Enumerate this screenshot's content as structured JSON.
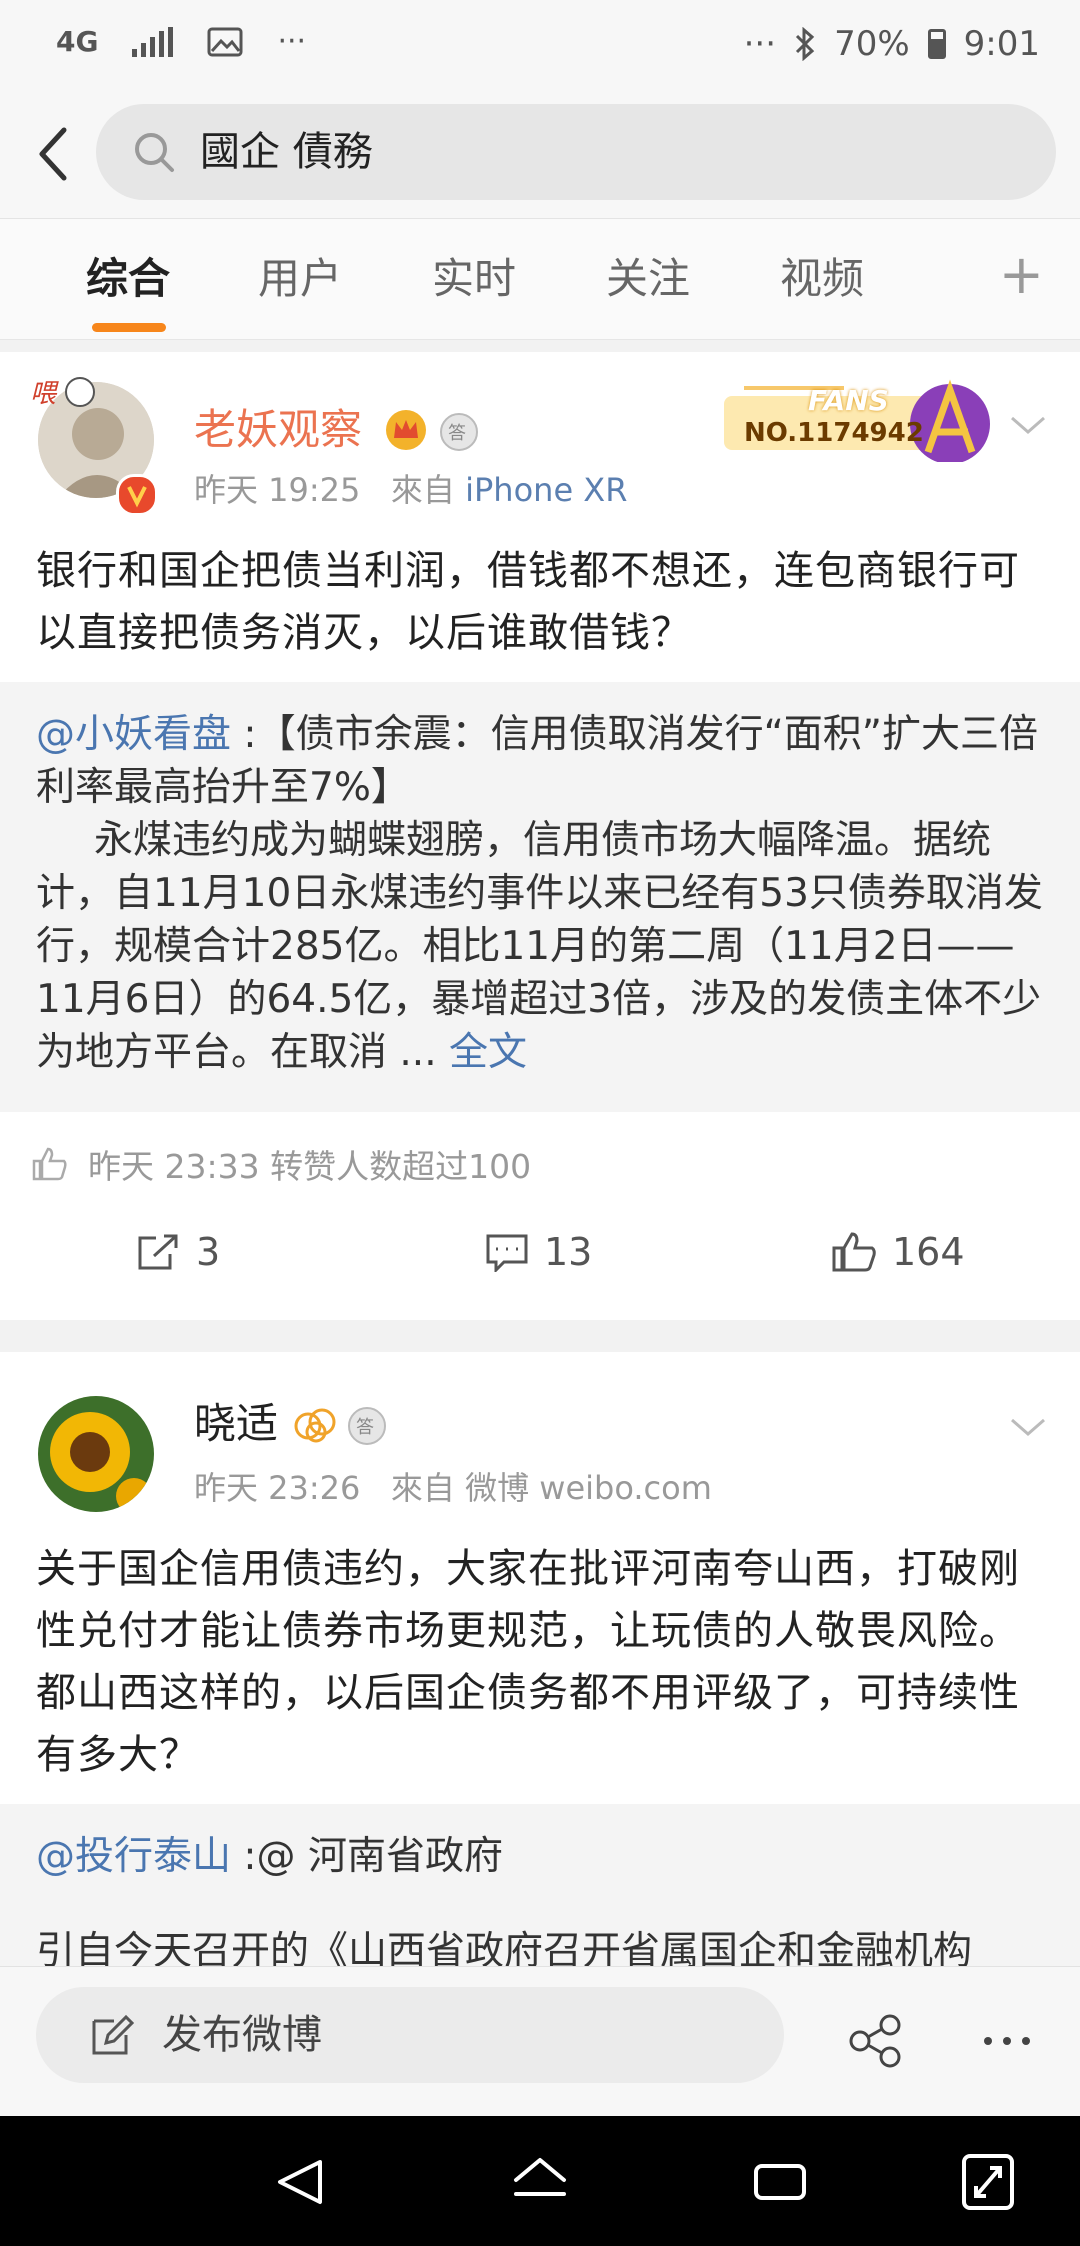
{
  "status_bar": {
    "network": "4G",
    "dots_left": "···",
    "dots_right": "···",
    "battery": "70%",
    "time": "9:01"
  },
  "search": {
    "query": "國企 債務"
  },
  "tabs": [
    {
      "label": "综合",
      "active": true
    },
    {
      "label": "用户",
      "active": false
    },
    {
      "label": "实时",
      "active": false
    },
    {
      "label": "关注",
      "active": false
    },
    {
      "label": "视频",
      "active": false
    }
  ],
  "tab_more": "+",
  "posts": [
    {
      "username": "老妖观察",
      "time": "昨天 19:25",
      "source_prefix": "來自",
      "source": "iPhone XR",
      "fans_badge": {
        "label": "FANS",
        "number": "NO.1174942"
      },
      "text": "银行和国企把债当利润，借钱都不想还，连包商银行可以直接把债务消灭，以后谁敢借钱？",
      "repost_author": "@小妖看盘",
      "repost_colon": ":",
      "repost_title": "【债市余震：信用债取消发行“面积”扩大三倍 利率最高抬升至7%】",
      "repost_body": "永煤违约成为蝴蝶翅膀，信用债市场大幅降温。据统计，自11月10日永煤违约事件以来已经有53只债券取消发行，规模合计285亿。相比11月的第二周（11月2日——11月6日）的64.5亿，暴增超过3倍，涉及的发债主体不少为地方平台。在取消 ...",
      "repost_more": "全文",
      "liked_info": "昨天 23:33 转赞人数超过100",
      "reposts": "3",
      "comments": "13",
      "likes": "164"
    },
    {
      "username": "晓适",
      "time": "昨天 23:26",
      "source_prefix": "來自",
      "source": "微博 weibo.com",
      "text": "关于国企信用债违约，大家在批评河南夸山西，打破刚性兑付才能让债券市场更规范，让玩债的人敬畏风险。都山西这样的，以后国企债务都不用评级了，可持续性有多大？",
      "repost_author": "@投行泰山",
      "repost_title": ":@ 河南省政府",
      "repost_body_partial": "引自今天召开的《山西省政府召开省属国企和金融机构"
    }
  ],
  "compose": {
    "label": "发布微博"
  },
  "colors": {
    "accent": "#f7861b",
    "link": "#4a76b0",
    "username_orange": "#eb7350"
  }
}
